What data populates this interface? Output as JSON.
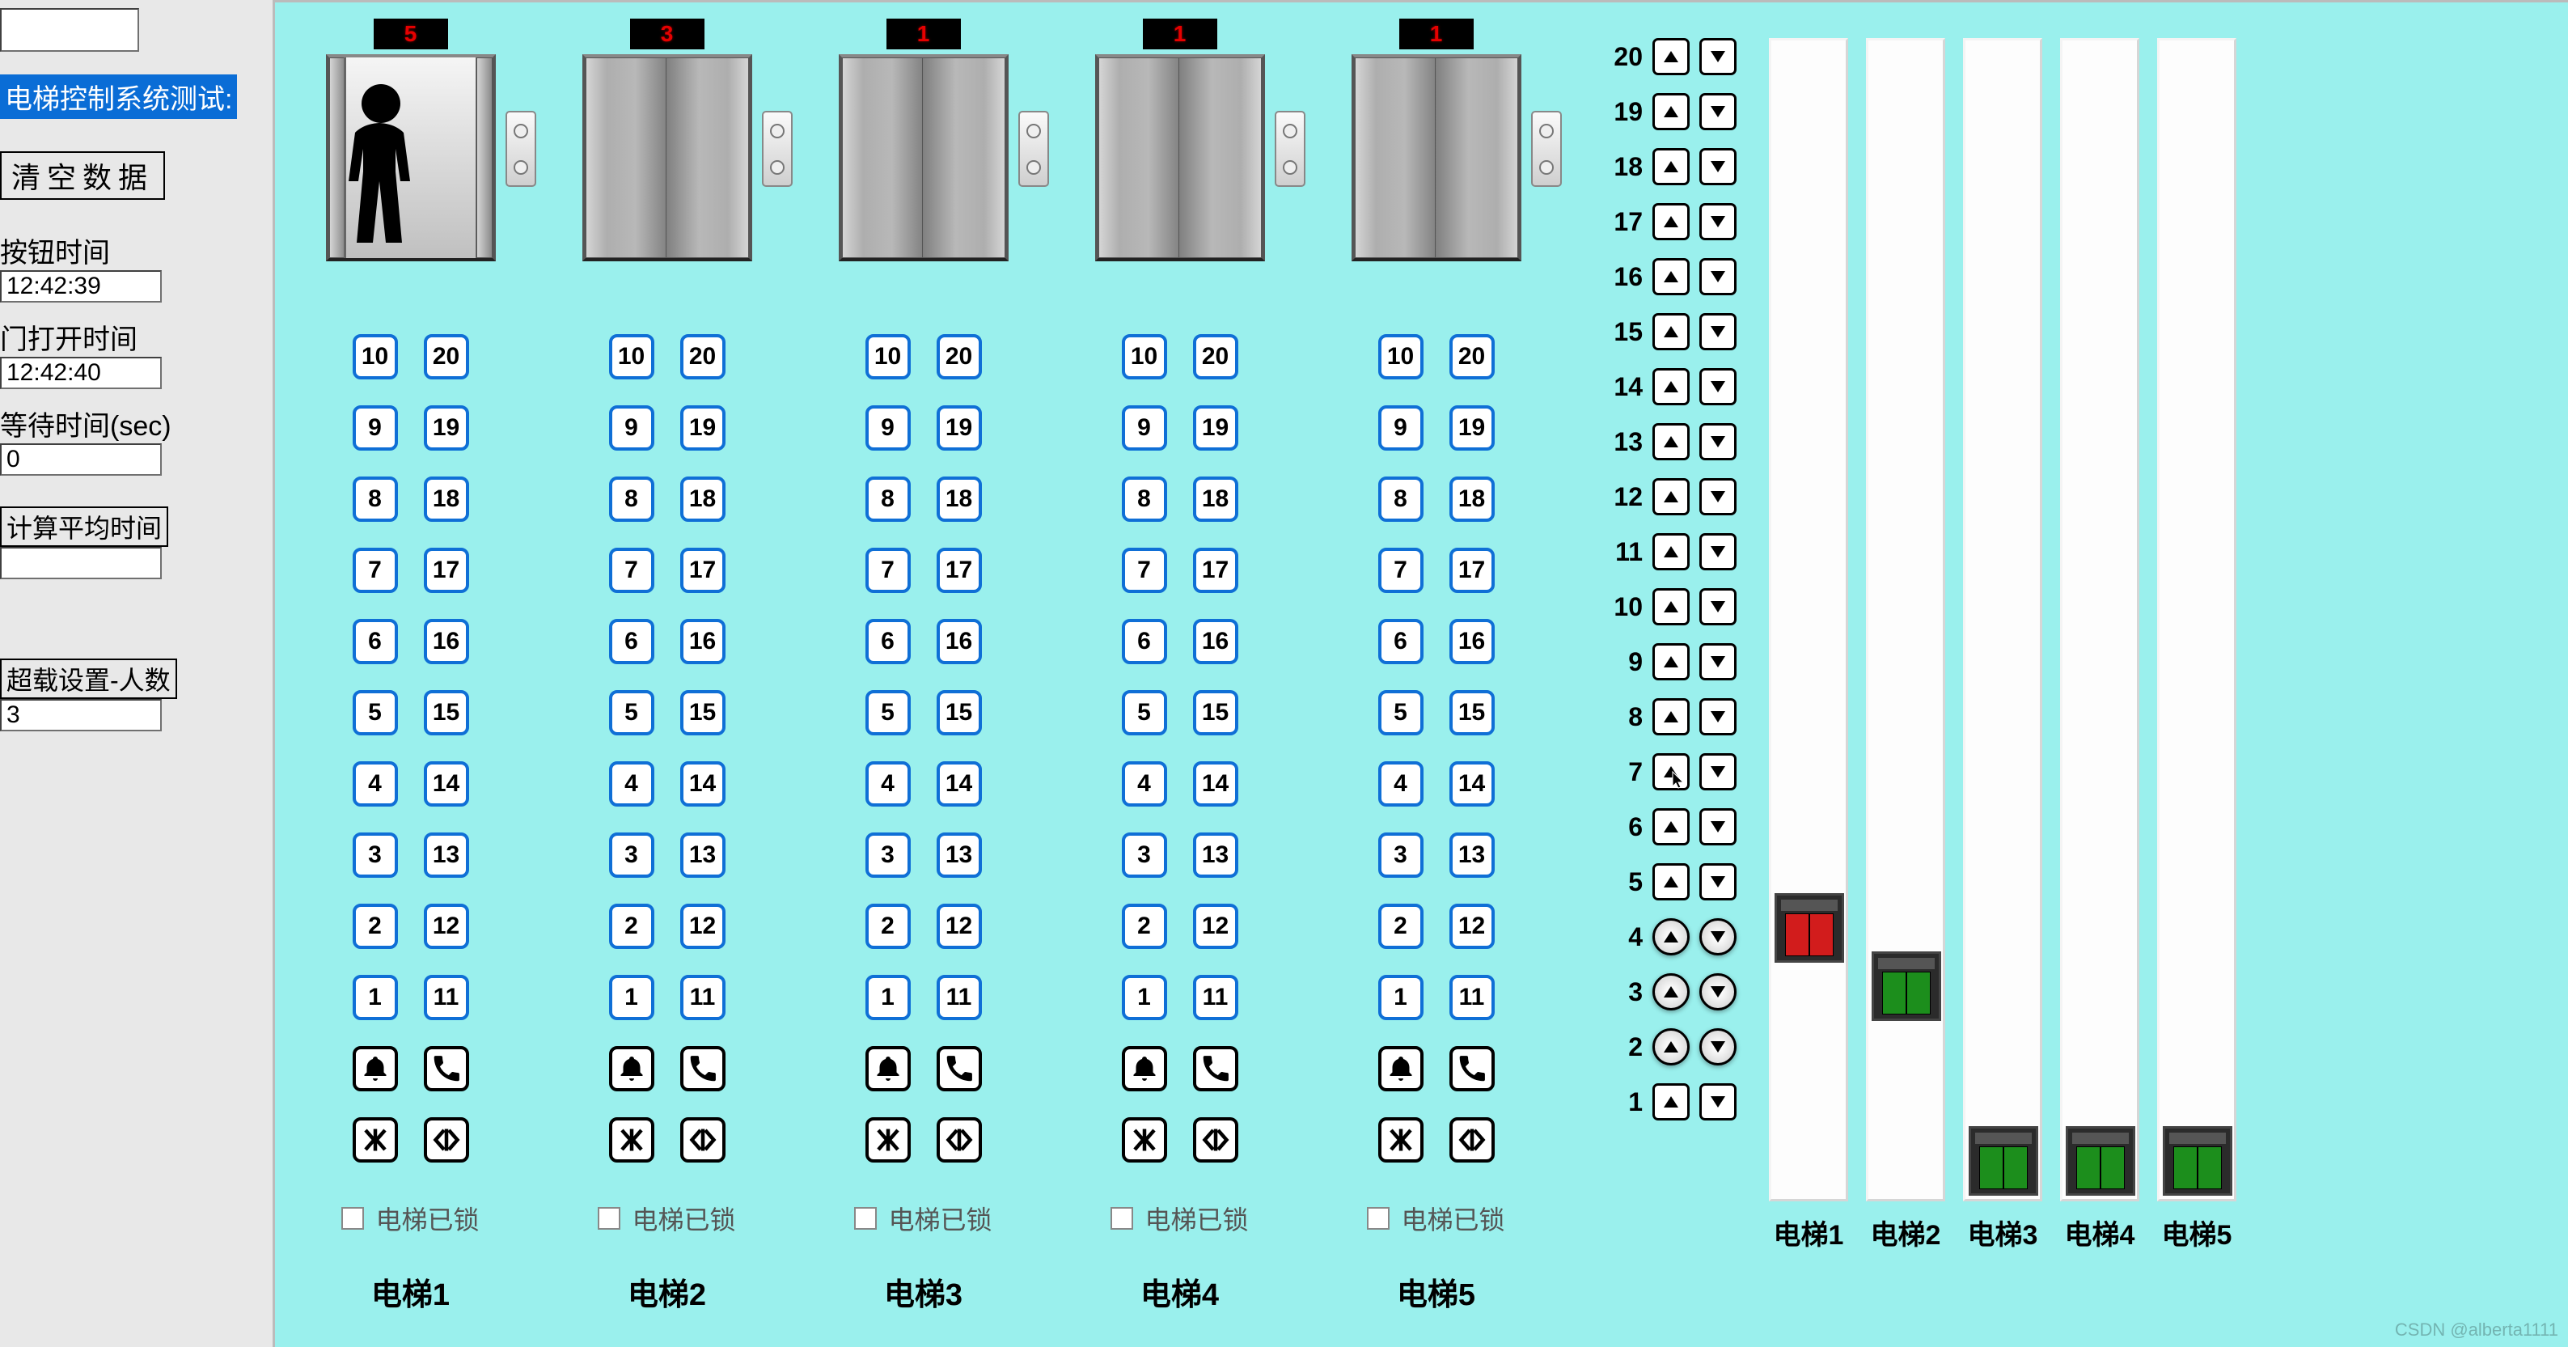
{
  "sidebar": {
    "title": "电梯控制系统测试:",
    "clear_button": "清空数据",
    "btn_time_label": "按钮时间",
    "btn_time_value": "12:42:39",
    "door_open_label": "门打开时间",
    "door_open_value": "12:42:40",
    "wait_label": "等待时间(sec)",
    "wait_value": "0",
    "avg_btn": "计算平均时间",
    "avg_value": "",
    "overload_label": "超载设置-人数",
    "overload_value": "3"
  },
  "shaft_indicator_values": [
    "5",
    "3",
    "1",
    "1",
    "1"
  ],
  "shaft_open_state": [
    true,
    false,
    false,
    false,
    false
  ],
  "inside_panel_left": [
    "10",
    "9",
    "8",
    "7",
    "6",
    "5",
    "4",
    "3",
    "2",
    "1"
  ],
  "inside_panel_right": [
    "20",
    "19",
    "18",
    "17",
    "16",
    "15",
    "14",
    "13",
    "12",
    "11"
  ],
  "lock_label": "电梯已锁",
  "shaft_names": [
    "电梯1",
    "电梯2",
    "电梯3",
    "电梯4",
    "电梯5"
  ],
  "floor_count": 20,
  "call_highlight_floor": 7,
  "pressed_floors": [
    2,
    3,
    4
  ],
  "bar_labels": [
    "电梯1",
    "电梯2",
    "电梯3",
    "电梯4",
    "电梯5"
  ],
  "cars": [
    {
      "floor": 5,
      "color": "red"
    },
    {
      "floor": 4,
      "color": "green"
    },
    {
      "floor": 1,
      "color": "green"
    },
    {
      "floor": 1,
      "color": "green"
    },
    {
      "floor": 1,
      "color": "green"
    }
  ],
  "watermark": "CSDN @alberta1111"
}
